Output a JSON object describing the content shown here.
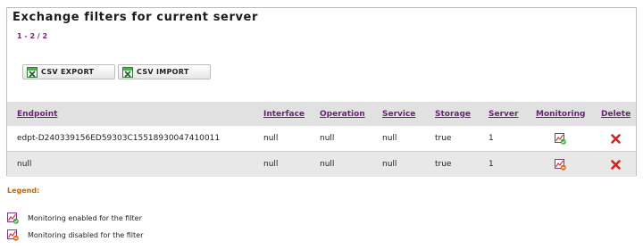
{
  "panel": {
    "title": "Exchange filters for current server",
    "paging": "1 - 2 / 2"
  },
  "toolbar": {
    "export_label": "CSV EXPORT",
    "import_label": "CSV IMPORT"
  },
  "table": {
    "columns": [
      "Endpoint",
      "Interface",
      "Operation",
      "Service",
      "Storage",
      "Server",
      "Monitoring",
      "Delete"
    ],
    "rows": [
      {
        "endpoint": "edpt-D240339156ED59303C15518930047410011",
        "interface": "null",
        "operation": "null",
        "service": "null",
        "storage": "true",
        "server": "1",
        "monitoring_icon": "monitoring-enabled-icon",
        "delete_icon": "delete-icon"
      },
      {
        "endpoint": "null",
        "interface": "null",
        "operation": "null",
        "service": "null",
        "storage": "true",
        "server": "1",
        "monitoring_icon": "monitoring-disabled-icon",
        "delete_icon": "delete-icon"
      }
    ]
  },
  "legend": {
    "title": "Legend:",
    "items": [
      {
        "icon": "monitoring-enabled-icon",
        "text": "Monitoring enabled for the filter"
      },
      {
        "icon": "monitoring-disabled-icon",
        "text": "Monitoring disabled for the filter"
      }
    ]
  },
  "colors": {
    "link": "#6c1f78",
    "legend_title": "#c86400",
    "header_bg": "#e1e1e1",
    "row_alt_bg": "#e8e8e8",
    "delete": "#d22222"
  }
}
